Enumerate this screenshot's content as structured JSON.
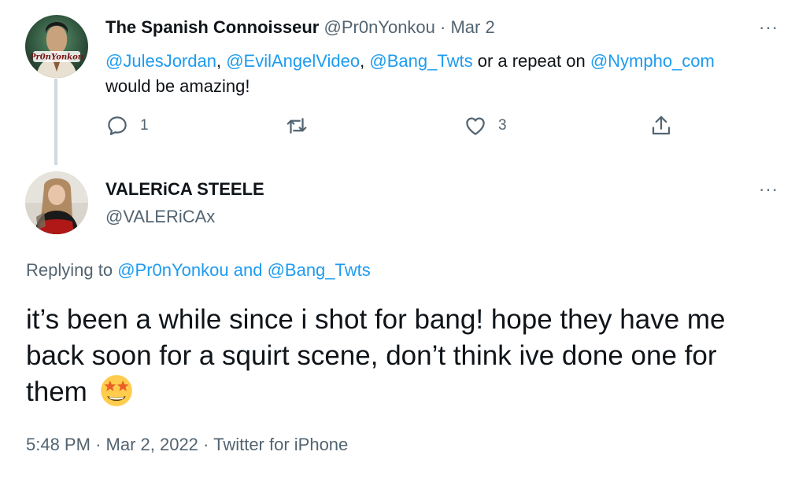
{
  "tweet1": {
    "display_name": "The Spanish Connoisseur",
    "handle": "@Pr0nYonkou",
    "separator": "·",
    "date": "Mar 2",
    "avatar_text": "Pr0nYonkou",
    "mentions": [
      "@JulesJordan",
      "@EvilAngelVideo",
      "@Bang_Twts",
      "@Nympho_com"
    ],
    "comma": ",",
    "text_or_repeat": "or a repeat on",
    "text_end": "would be amazing!",
    "reply_count": "1",
    "like_count": "3",
    "more_label": "···"
  },
  "tweet2": {
    "display_name": "VALERiCA STEELE",
    "handle": "@VALERiCAx",
    "more_label": "···",
    "replying_prefix": "Replying to",
    "replying_user1": "@Pr0nYonkou",
    "replying_and": "and",
    "replying_user2": "@Bang_Twts",
    "text": "it’s been a while since i shot for bang! hope they have me back soon for a squirt scene, don’t think ive done one for them",
    "emoji": "star-struck-emoji",
    "time": "5:48 PM",
    "separator": "·",
    "date": "Mar 2, 2022",
    "source": "Twitter for iPhone"
  },
  "icons": [
    "reply-icon",
    "retweet-icon",
    "like-icon",
    "share-icon",
    "more-icon"
  ],
  "colors": {
    "link": "#1d9bf0",
    "muted": "#536471",
    "text": "#0f1419",
    "thread": "#cfd9de"
  }
}
